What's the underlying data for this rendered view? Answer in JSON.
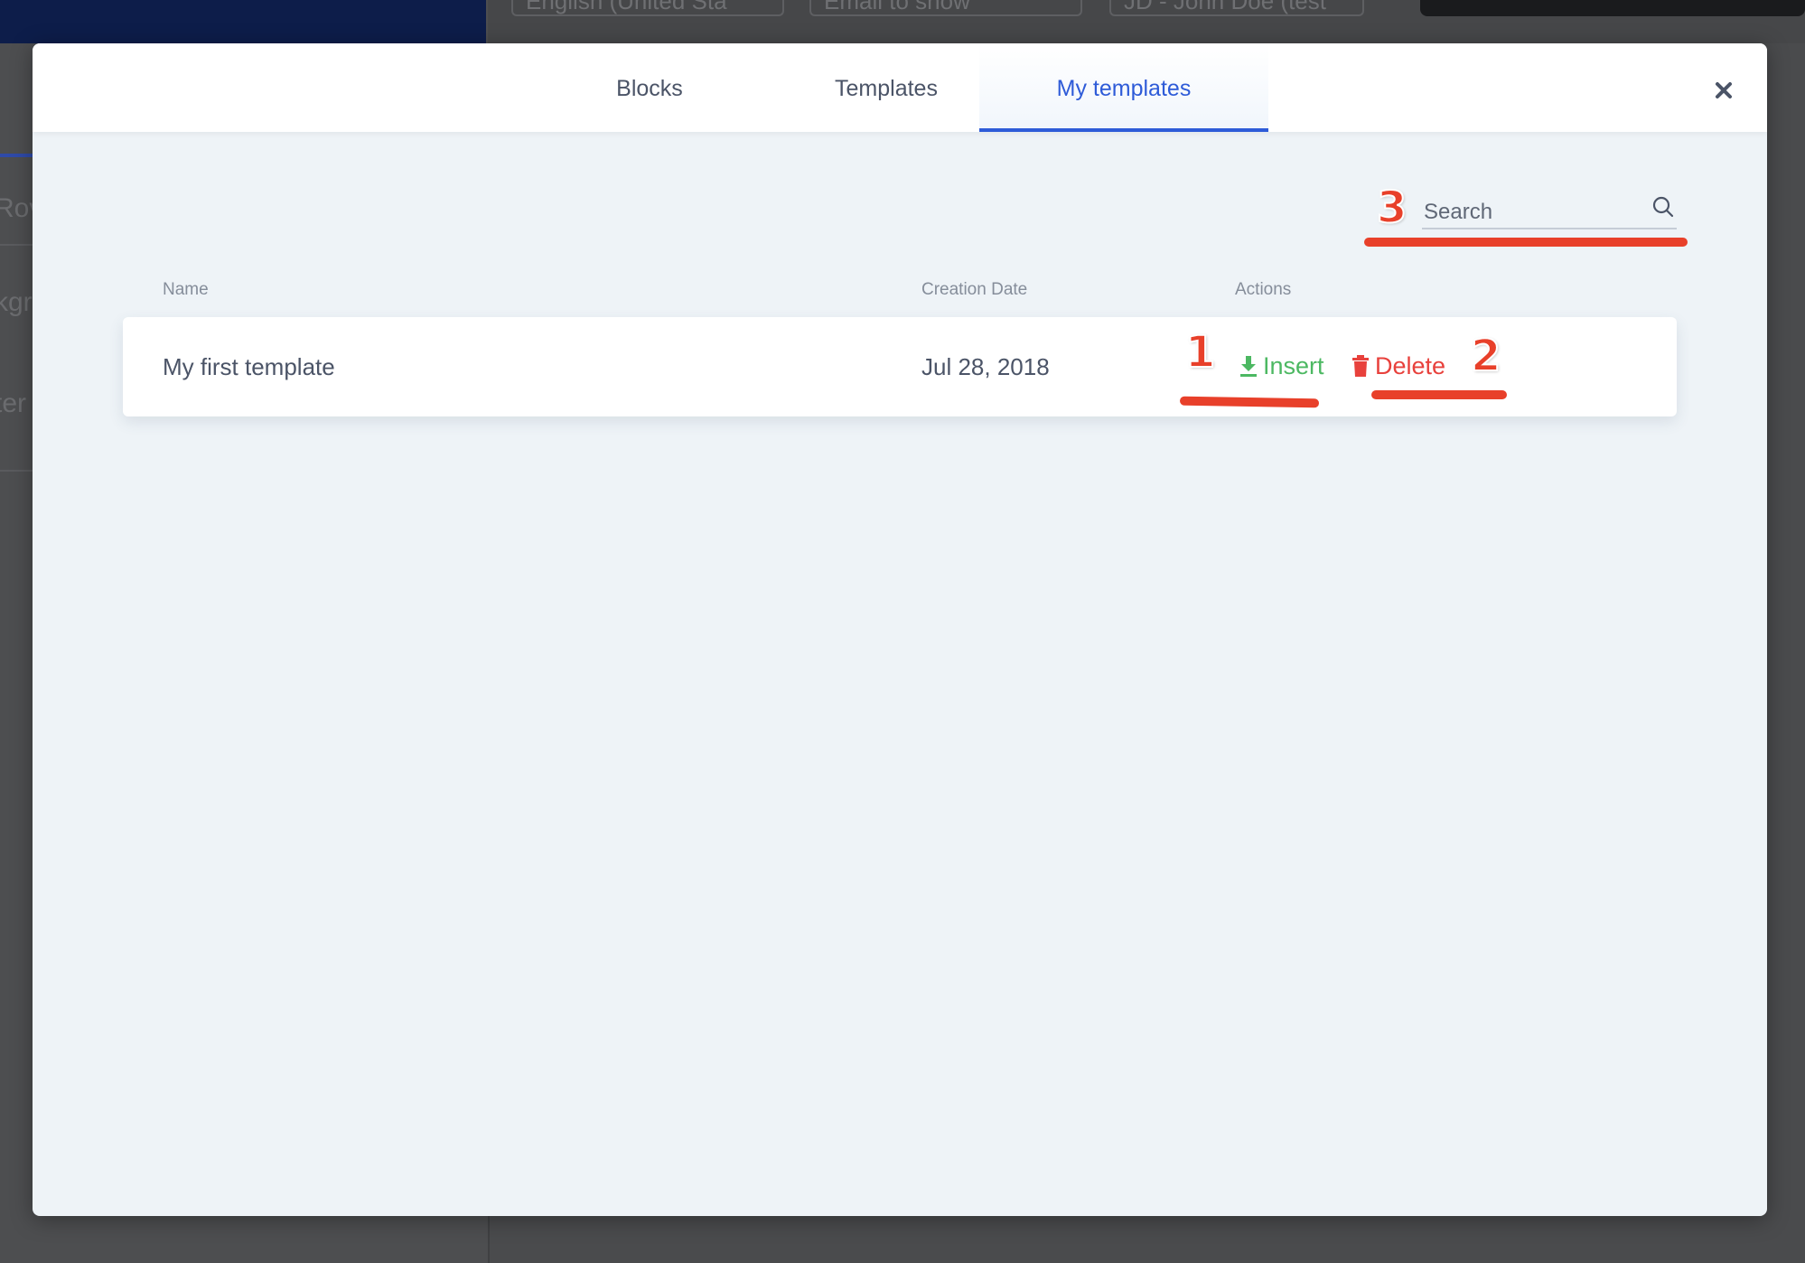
{
  "background_app": {
    "topbar_selects": [
      "English (United Sta",
      "Email to show",
      "JD - John Doe (test"
    ],
    "left_panel_texts": [
      "Rov",
      "kgr",
      "ter"
    ]
  },
  "modal": {
    "tabs": [
      {
        "label": "Blocks"
      },
      {
        "label": "Templates"
      },
      {
        "label": "My templates"
      }
    ],
    "active_tab": "My templates",
    "close_icon": "close-icon",
    "search": {
      "placeholder": "Search",
      "value": ""
    },
    "table": {
      "headers": {
        "name": "Name",
        "creation_date": "Creation Date",
        "actions": "Actions"
      },
      "rows": [
        {
          "name": "My first template",
          "creation_date": "Jul 28, 2018",
          "insert_label": "Insert",
          "delete_label": "Delete"
        }
      ]
    }
  },
  "annotations": {
    "insert_marker": "1",
    "delete_marker": "2",
    "search_marker": "3"
  },
  "colors": {
    "accent": "#2e5bd8",
    "insert": "#4cb862",
    "delete": "#e8413c",
    "annotation": "#e8402a",
    "modal_bg": "#eef3f7",
    "brand_bar": "#0d1d4a"
  }
}
